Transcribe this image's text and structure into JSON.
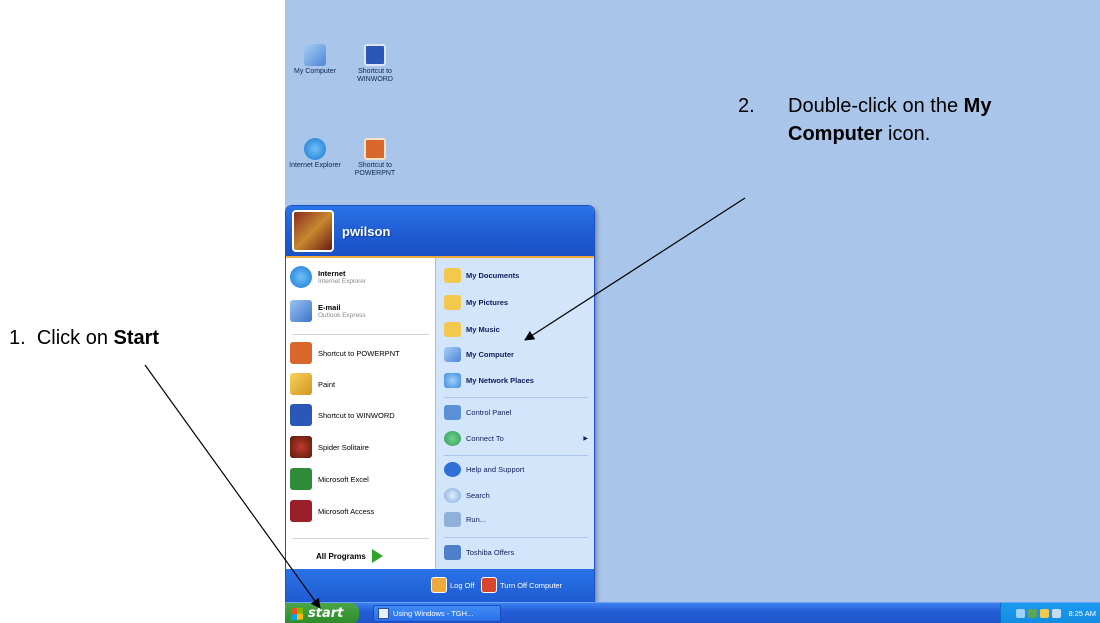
{
  "desktop": {
    "icons": [
      {
        "label": "My Computer",
        "icon": "my-computer-icon",
        "color": "#6aa3e8"
      },
      {
        "label": "Shortcut to WINWORD",
        "icon": "word-icon",
        "color": "#2b58b8"
      },
      {
        "label": "Internet Explorer",
        "icon": "internet-explorer-icon",
        "color": "#1a78d6"
      },
      {
        "label": "Shortcut to POWERPNT",
        "icon": "powerpoint-icon",
        "color": "#d9662a"
      }
    ]
  },
  "start_menu": {
    "username": "pwilson",
    "pinned": [
      {
        "name": "Internet",
        "sub": "Internet Explorer",
        "icon": "internet-explorer-icon",
        "color": "#1a78d6"
      },
      {
        "name": "E-mail",
        "sub": "Outlook Express",
        "icon": "outlook-express-icon",
        "color": "#3a74c8"
      }
    ],
    "recent": [
      {
        "name": "Shortcut to POWERPNT",
        "icon": "powerpoint-icon",
        "color": "#d9662a"
      },
      {
        "name": "Paint",
        "icon": "paint-icon",
        "color": "#e2b23a"
      },
      {
        "name": "Shortcut to WINWORD",
        "icon": "word-icon",
        "color": "#2b58b8"
      },
      {
        "name": "Spider Solitaire",
        "icon": "spider-solitaire-icon",
        "color": "#7b3a1a"
      },
      {
        "name": "Microsoft Excel",
        "icon": "excel-icon",
        "color": "#2e8b3a"
      },
      {
        "name": "Microsoft Access",
        "icon": "access-icon",
        "color": "#9b1f2a"
      }
    ],
    "all_programs": "All Programs",
    "right_items": [
      {
        "name": "My Documents",
        "icon": "my-documents-icon",
        "color": "#f2c94c",
        "bold": true
      },
      {
        "name": "My Pictures",
        "icon": "my-pictures-icon",
        "color": "#f2c94c",
        "bold": true
      },
      {
        "name": "My Music",
        "icon": "my-music-icon",
        "color": "#f2c94c",
        "bold": true
      },
      {
        "name": "My Computer",
        "icon": "my-computer-icon",
        "color": "#6aa3e8",
        "bold": true
      },
      {
        "name": "My Network Places",
        "icon": "network-places-icon",
        "color": "#3d8be0",
        "bold": true
      },
      {
        "name": "Control Panel",
        "icon": "control-panel-icon",
        "color": "#5b8fd6",
        "bold": false
      },
      {
        "name": "Connect To",
        "icon": "connect-to-icon",
        "color": "#2f9b5a",
        "bold": false,
        "submenu": true
      },
      {
        "name": "Help and Support",
        "icon": "help-icon",
        "color": "#2f6fd6",
        "bold": false
      },
      {
        "name": "Search",
        "icon": "search-icon",
        "color": "#7aa6e0",
        "bold": false
      },
      {
        "name": "Run...",
        "icon": "run-icon",
        "color": "#8fb0d8",
        "bold": false
      },
      {
        "name": "Toshiba Offers",
        "icon": "toshiba-offers-icon",
        "color": "#4f7fc8",
        "bold": false
      }
    ],
    "footer": {
      "log_off": "Log Off",
      "turn_off": "Turn Off Computer"
    }
  },
  "taskbar": {
    "start_label": "start",
    "task": "Using Windows - TGH...",
    "clock": "8:25 AM"
  },
  "annotations": {
    "step1_num": "1.",
    "step1_pre": "Click on ",
    "step1_bold": "Start",
    "step2_num": "2.",
    "step2_pre": "Double-click on the ",
    "step2_bold": "My Computer",
    "step2_post": " icon."
  }
}
